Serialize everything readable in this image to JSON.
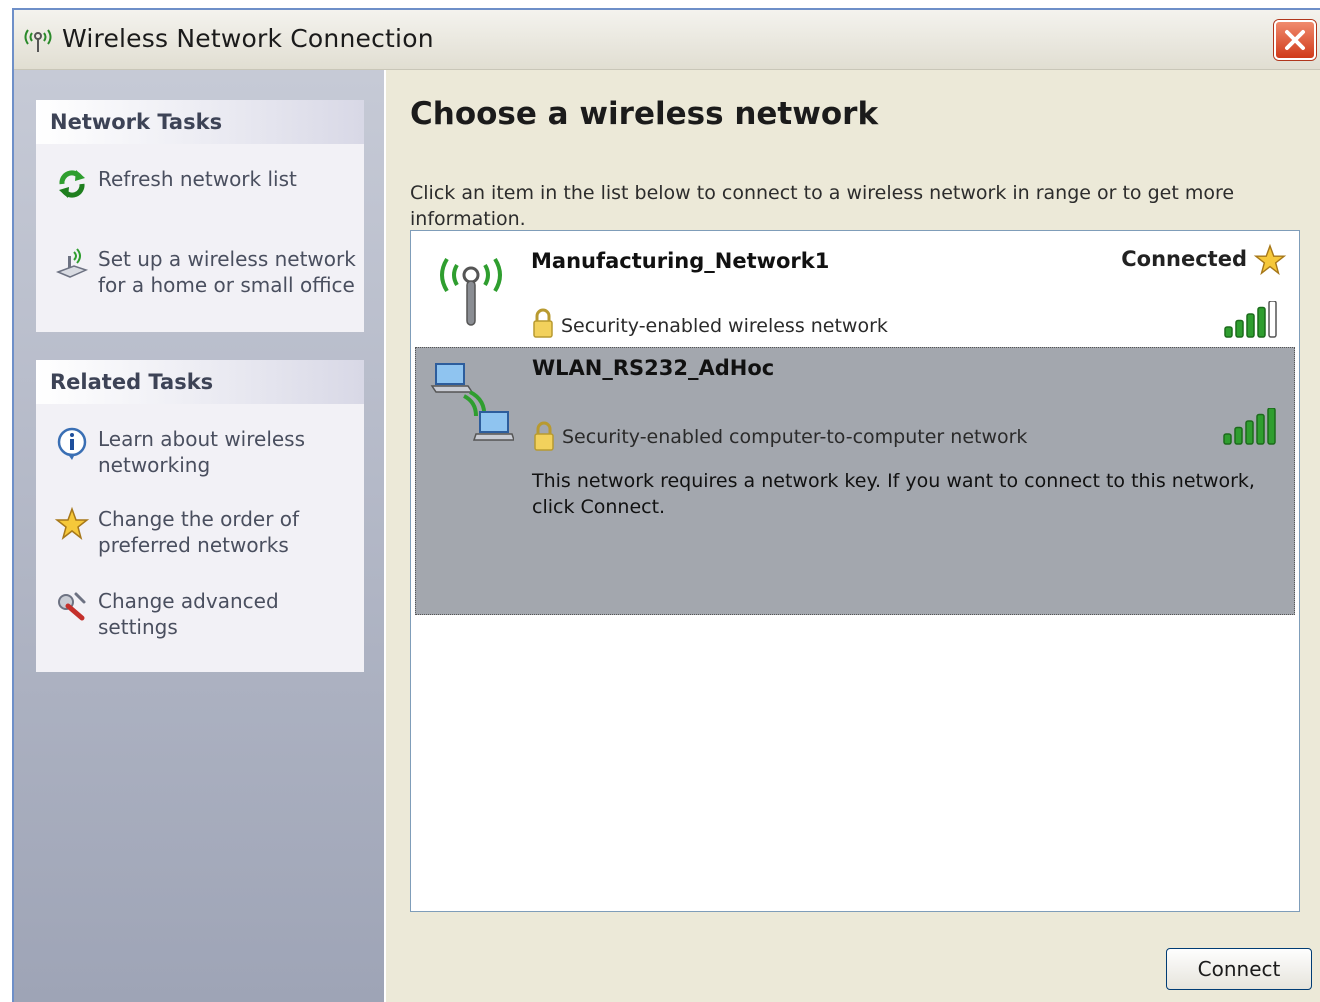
{
  "window": {
    "title": "Wireless Network Connection"
  },
  "sidebar": {
    "network_tasks": {
      "heading": "Network Tasks",
      "items": [
        {
          "label": "Refresh network list",
          "icon": "refresh-icon"
        },
        {
          "label": "Set up a wireless network for a home or small office",
          "icon": "setup-wizard-icon"
        }
      ]
    },
    "related_tasks": {
      "heading": "Related Tasks",
      "items": [
        {
          "label": "Learn about wireless networking",
          "icon": "info-icon"
        },
        {
          "label": "Change the order of preferred networks",
          "icon": "star-icon"
        },
        {
          "label": "Change advanced settings",
          "icon": "settings-icon"
        }
      ]
    }
  },
  "main": {
    "title": "Choose a wireless network",
    "description": "Click an item in the list below to connect to a wireless network in range or to get more information.",
    "networks": [
      {
        "name": "Manufacturing_Network1",
        "status": "Connected",
        "security": "Security-enabled wireless network",
        "signal_bars": 4,
        "signal_max": 5,
        "icon": "access-point-icon"
      },
      {
        "name": "WLAN_RS232_AdHoc",
        "status": "",
        "security": "Security-enabled computer-to-computer network",
        "message": "This network requires a network key. If you want to connect to this network, click Connect.",
        "signal_bars": 5,
        "signal_max": 5,
        "icon": "adhoc-computers-icon",
        "selected": true
      }
    ],
    "connect_label": "Connect"
  },
  "colors": {
    "signal_green": "#2f9e2f",
    "selected_row": "#a3a7ae",
    "close_red": "#d03a1a"
  }
}
